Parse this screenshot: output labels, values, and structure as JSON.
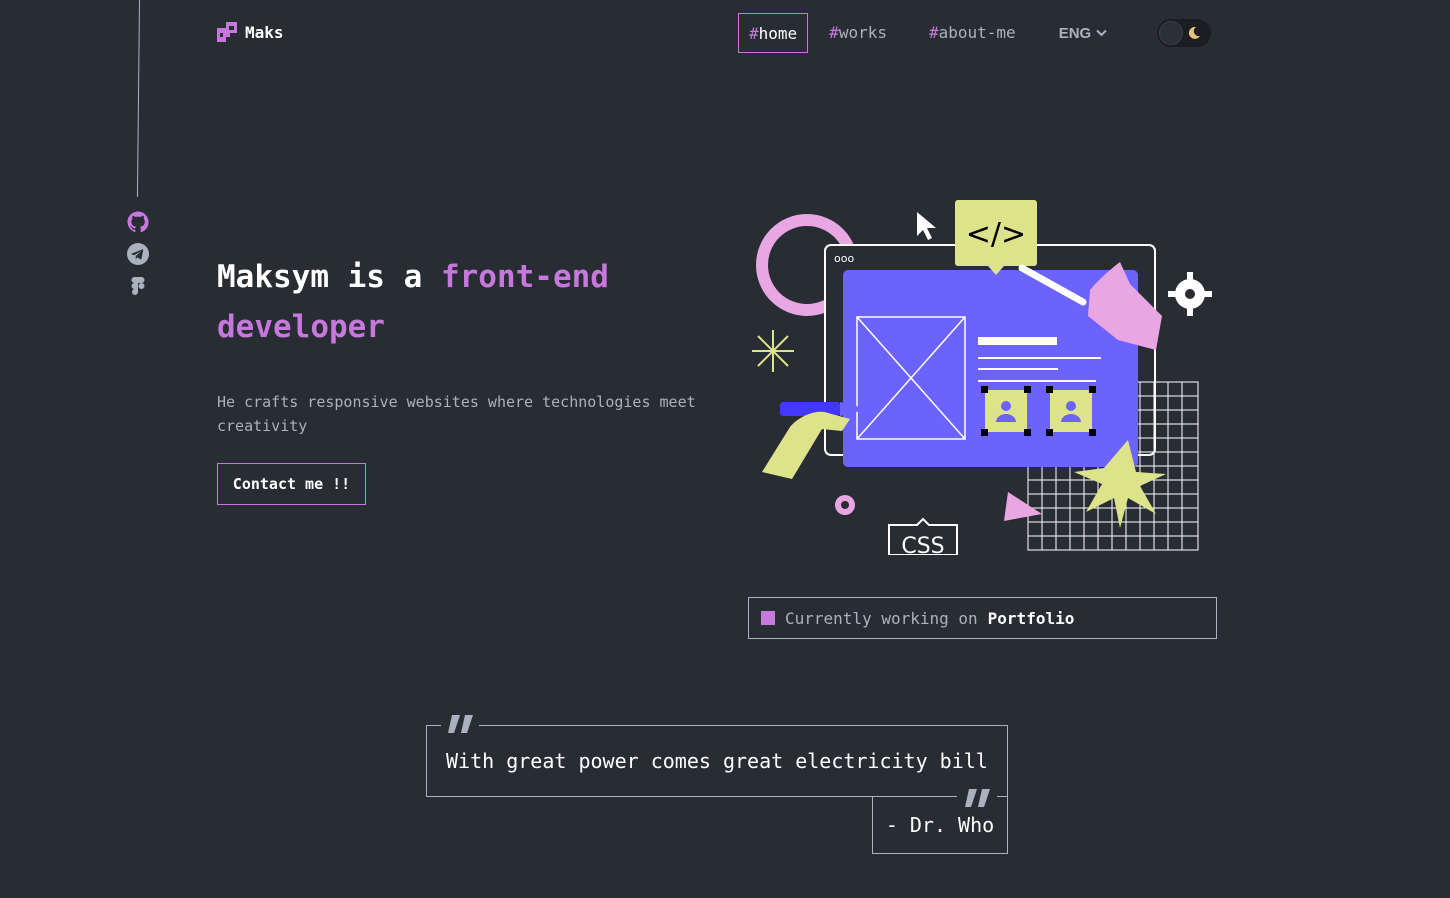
{
  "brand": {
    "name": "Maks"
  },
  "nav": {
    "items": [
      {
        "hash": "#",
        "label": "home",
        "active": true
      },
      {
        "hash": "#",
        "label": "works",
        "active": false
      },
      {
        "hash": "#",
        "label": "about-me",
        "active": false
      }
    ],
    "language": "ENG",
    "theme": "dark"
  },
  "socials": [
    "github-icon",
    "telegram-icon",
    "figma-icon"
  ],
  "hero": {
    "title_prefix": "Maksym is a ",
    "title_accent": "front-end developer",
    "description": "He crafts responsive websites where technologies meet creativity",
    "cta_label": "Contact me !!"
  },
  "illustration": {
    "code_tag": "</>",
    "css_tag": "CSS",
    "window_dots": "ooo"
  },
  "status": {
    "prefix": "Currently working on",
    "project": "Portfolio"
  },
  "quote": {
    "text": "With great power comes great electricity bill",
    "author": "- Dr. Who"
  },
  "colors": {
    "background": "#282c33",
    "accent": "#c778dd",
    "text_gray": "#abb2bf",
    "illustration_purple": "#6c63ff",
    "illustration_lime": "#dde38b"
  }
}
